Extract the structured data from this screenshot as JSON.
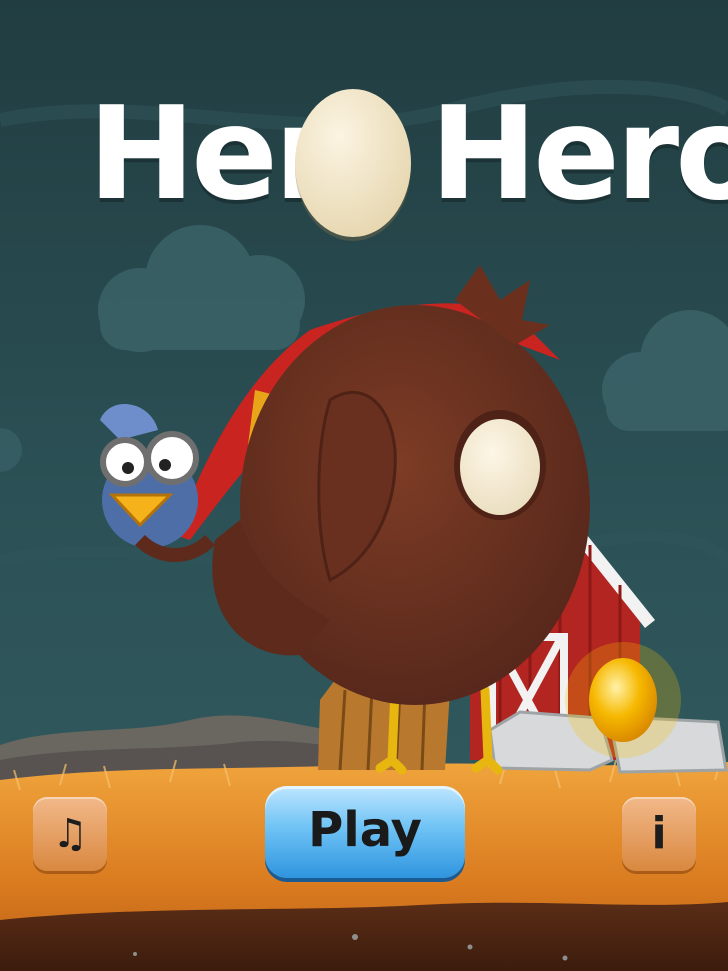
{
  "title": {
    "left": "Hen",
    "right": "Hero"
  },
  "buttons": {
    "play_label": "Play",
    "music_glyph": "♫",
    "info_glyph": "i"
  },
  "icons": {
    "music": "music-note-icon",
    "info": "info-icon",
    "egg": "egg-icon"
  },
  "colors": {
    "sky": "#24454a",
    "hen_body": "#6e3320",
    "cape": "#c9241f",
    "grass": "#e38a2a",
    "play_button": "#4aaaf0",
    "golden_egg": "#f0a800"
  }
}
